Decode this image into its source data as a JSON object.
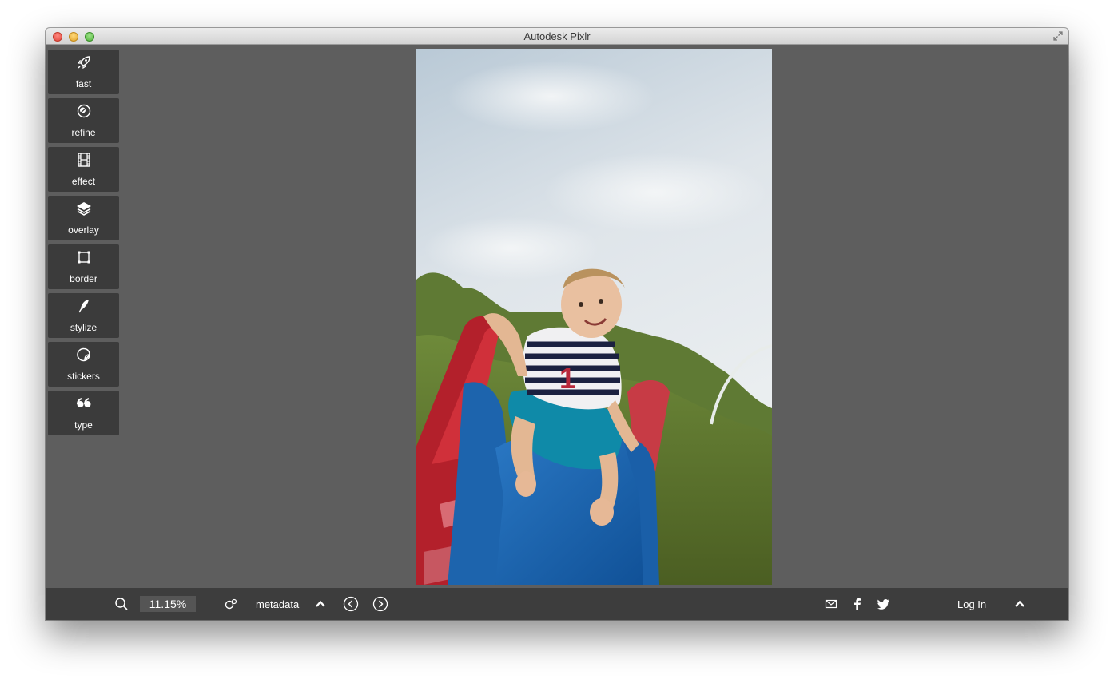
{
  "window": {
    "title": "Autodesk Pixlr"
  },
  "tools": [
    {
      "label": "fast",
      "icon": "rocket-icon"
    },
    {
      "label": "refine",
      "icon": "refine-circles-icon"
    },
    {
      "label": "effect",
      "icon": "film-strip-icon"
    },
    {
      "label": "overlay",
      "icon": "layers-icon"
    },
    {
      "label": "border",
      "icon": "border-frame-icon"
    },
    {
      "label": "stylize",
      "icon": "quill-pen-icon"
    },
    {
      "label": "stickers",
      "icon": "sticker-icon"
    },
    {
      "label": "type",
      "icon": "quote-marks-icon"
    }
  ],
  "bottombar": {
    "zoom": "11.15%",
    "metadata_label": "metadata",
    "login_label": "Log In",
    "icons": [
      "search-icon",
      "compare-icon",
      "chevron-up-icon",
      "previous-icon",
      "next-icon",
      "mail-icon",
      "facebook-icon",
      "twitter-icon",
      "chevron-up-icon"
    ]
  },
  "colors": {
    "workspace": "#5e5e5e",
    "panel": "#3b3b3b",
    "bottombar": "#3d3d3d",
    "text": "#ffffff"
  }
}
